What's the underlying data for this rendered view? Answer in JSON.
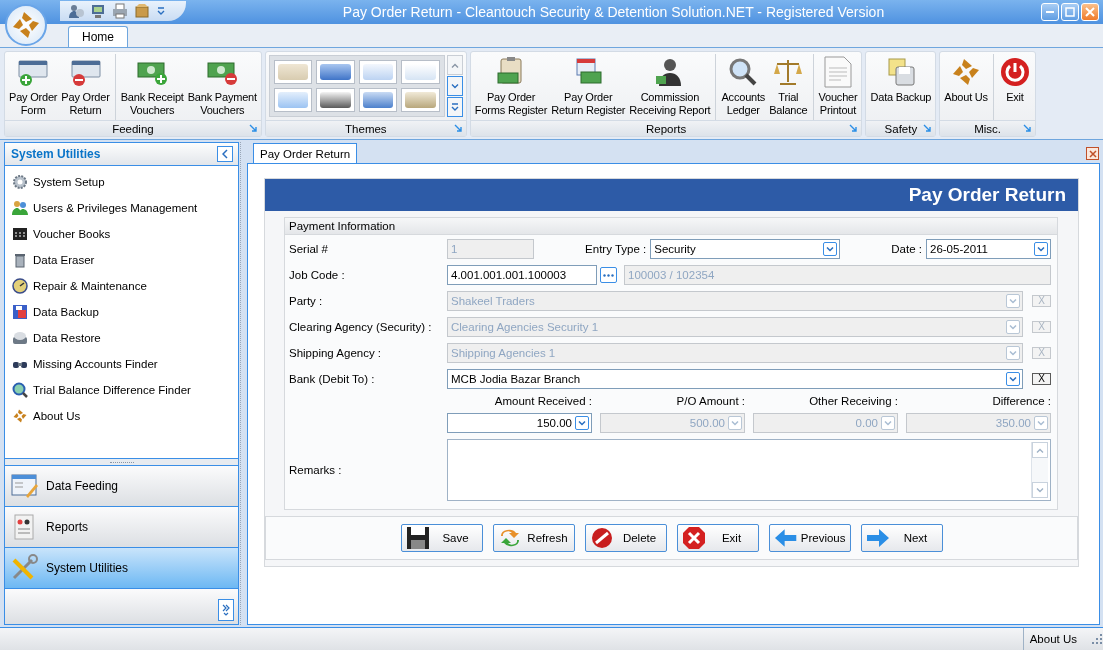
{
  "window": {
    "title": "Pay Order Return - Cleantouch Security & Detention Solution.NET - Registered Version"
  },
  "ribbon": {
    "tabs": [
      {
        "label": "Home",
        "selected": true
      }
    ],
    "groups": [
      {
        "label": "Feeding",
        "kind": "buttons",
        "items": [
          {
            "lines": [
              "Pay Order",
              "Form"
            ],
            "divider_after": false
          },
          {
            "lines": [
              "Pay Order",
              "Return"
            ],
            "divider_after": true
          },
          {
            "lines": [
              "Bank Receipt",
              "Vouchers"
            ],
            "divider_after": false
          },
          {
            "lines": [
              "Bank Payment",
              "Vouchers"
            ],
            "divider_after": false
          }
        ]
      },
      {
        "label": "Themes",
        "kind": "gallery"
      },
      {
        "label": "Reports",
        "kind": "buttons",
        "items": [
          {
            "lines": [
              "Pay Order",
              "Forms Register"
            ],
            "divider_after": false
          },
          {
            "lines": [
              "Pay Order",
              "Return Register"
            ],
            "divider_after": false
          },
          {
            "lines": [
              "Commission",
              "Receiving Report"
            ],
            "divider_after": true
          },
          {
            "lines": [
              "Accounts",
              "Ledger"
            ],
            "divider_after": false
          },
          {
            "lines": [
              "Trial",
              "Balance"
            ],
            "divider_after": true
          },
          {
            "lines": [
              "Voucher",
              "Printout"
            ],
            "divider_after": false
          }
        ]
      },
      {
        "label": "Safety",
        "kind": "buttons",
        "items": [
          {
            "lines": [
              "Data Backup"
            ],
            "divider_after": false
          }
        ]
      },
      {
        "label": "Misc.",
        "kind": "buttons",
        "items": [
          {
            "lines": [
              "About Us"
            ],
            "divider_after": true
          },
          {
            "lines": [
              "Exit"
            ],
            "divider_after": false
          }
        ]
      }
    ]
  },
  "sidebar": {
    "header": "System Utilities",
    "items": [
      {
        "label": "System Setup"
      },
      {
        "label": "Users & Privileges Management"
      },
      {
        "label": "Voucher Books"
      },
      {
        "label": "Data Eraser"
      },
      {
        "label": "Repair & Maintenance"
      },
      {
        "label": "Data Backup"
      },
      {
        "label": "Data Restore"
      },
      {
        "label": "Missing Accounts Finder"
      },
      {
        "label": "Trial Balance Difference Finder"
      },
      {
        "label": "About Us"
      }
    ],
    "nav": [
      {
        "label": "Data Feeding",
        "selected": false
      },
      {
        "label": "Reports",
        "selected": false
      },
      {
        "label": "System Utilities",
        "selected": true
      }
    ]
  },
  "document_tabs": [
    {
      "label": "Pay Order Return",
      "selected": true
    }
  ],
  "form": {
    "title": "Pay Order Return",
    "section": "Payment Information",
    "serial": {
      "label": "Serial #",
      "value": "1",
      "disabled": true
    },
    "entry_type": {
      "label": "Entry Type :",
      "value": "Security",
      "disabled": false
    },
    "date": {
      "label": "Date :",
      "value": "26-05-2011",
      "disabled": false
    },
    "job_code": {
      "label": "Job Code :",
      "value": "4.001.001.001.100003",
      "detail": "100003 / 102354"
    },
    "lookups": [
      {
        "label": "Party :",
        "value": "Shakeel Traders",
        "clear": "X",
        "disabled": true
      },
      {
        "label": "Clearing Agency (Security) :",
        "value": "Clearing Agencies Security 1",
        "clear": "X",
        "disabled": true
      },
      {
        "label": "Shipping Agency :",
        "value": "Shipping Agencies 1",
        "clear": "X",
        "disabled": true
      },
      {
        "label": "Bank (Debit To) :",
        "value": "MCB Jodia Bazar Branch",
        "clear": "X",
        "disabled": false
      }
    ],
    "amounts": [
      {
        "label": "Amount Received :",
        "value": "150.00",
        "disabled": false
      },
      {
        "label": "P/O Amount :",
        "value": "500.00",
        "disabled": true
      },
      {
        "label": "Other Receiving :",
        "value": "0.00",
        "disabled": true
      },
      {
        "label": "Difference :",
        "value": "350.00",
        "disabled": true
      }
    ],
    "remarks": {
      "label": "Remarks :"
    },
    "buttons": [
      {
        "label": "Save"
      },
      {
        "label": "Refresh"
      },
      {
        "label": "Delete"
      },
      {
        "label": "Exit"
      },
      {
        "label": "Previous"
      },
      {
        "label": "Next"
      }
    ]
  },
  "status_bar": {
    "text": "About Us"
  }
}
